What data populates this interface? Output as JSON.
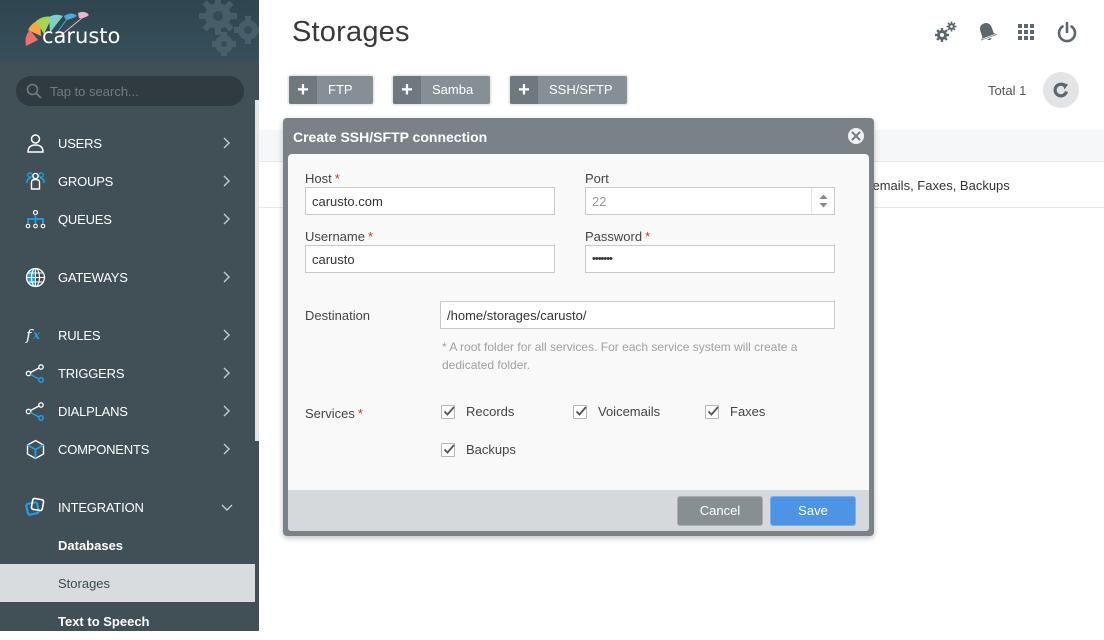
{
  "app": {
    "logo_text": "carusto"
  },
  "sidebar": {
    "search_placeholder": "Tap to search...",
    "items": [
      {
        "label": "USERS",
        "icon": "user-icon"
      },
      {
        "label": "GROUPS",
        "icon": "group-icon"
      },
      {
        "label": "QUEUES",
        "icon": "queue-hierarchy-icon"
      },
      {
        "label": "GATEWAYS",
        "icon": "globe-icon"
      },
      {
        "label": "RULES",
        "icon": "function-fx-icon"
      },
      {
        "label": "TRIGGERS",
        "icon": "share-nodes-icon"
      },
      {
        "label": "DIALPLANS",
        "icon": "share-nodes-icon"
      },
      {
        "label": "COMPONENTS",
        "icon": "cube-icon"
      },
      {
        "label": "INTEGRATION",
        "icon": "integration-squares-icon",
        "expanded": true
      }
    ],
    "subitems": [
      {
        "label": "Databases",
        "active": false
      },
      {
        "label": "Storages",
        "active": true
      },
      {
        "label": "Text to Speech",
        "active": false
      }
    ]
  },
  "header": {
    "title": "Storages",
    "icons": [
      "settings-gears-icon",
      "notifications-bell-icon",
      "apps-grid-icon",
      "power-icon"
    ]
  },
  "toolbar": {
    "buttons": [
      {
        "label": "FTP"
      },
      {
        "label": "Samba"
      },
      {
        "label": "SSH/SFTP"
      }
    ],
    "total_label": "Total 1"
  },
  "table": {
    "rows": [
      {
        "services_visible": "cemails, Faxes, Backups"
      }
    ]
  },
  "dialog": {
    "title": "Create SSH/SFTP connection",
    "host": {
      "label": "Host",
      "required": "*",
      "value": "carusto.com"
    },
    "port": {
      "label": "Port",
      "value": "22"
    },
    "username": {
      "label": "Username",
      "required": "*",
      "value": "carusto"
    },
    "password": {
      "label": "Password",
      "required": "*",
      "value": "•••••••"
    },
    "destination": {
      "label": "Destination",
      "value": "/home/storages/carusto/",
      "hint": "* A root folder for all services. For each service system will create a dedicated folder."
    },
    "services": {
      "label": "Services",
      "required": "*",
      "options": [
        {
          "label": "Records",
          "checked": true
        },
        {
          "label": "Voicemails",
          "checked": true
        },
        {
          "label": "Faxes",
          "checked": true
        },
        {
          "label": "Backups",
          "checked": true
        }
      ]
    },
    "cancel_label": "Cancel",
    "save_label": "Save"
  },
  "colors": {
    "sidebar_bg": "#414f56",
    "accent_blue": "#1ea0e6",
    "save_button": "#4d95e4",
    "dialog_frame": "#7a8288",
    "required_star": "#c0392b"
  }
}
